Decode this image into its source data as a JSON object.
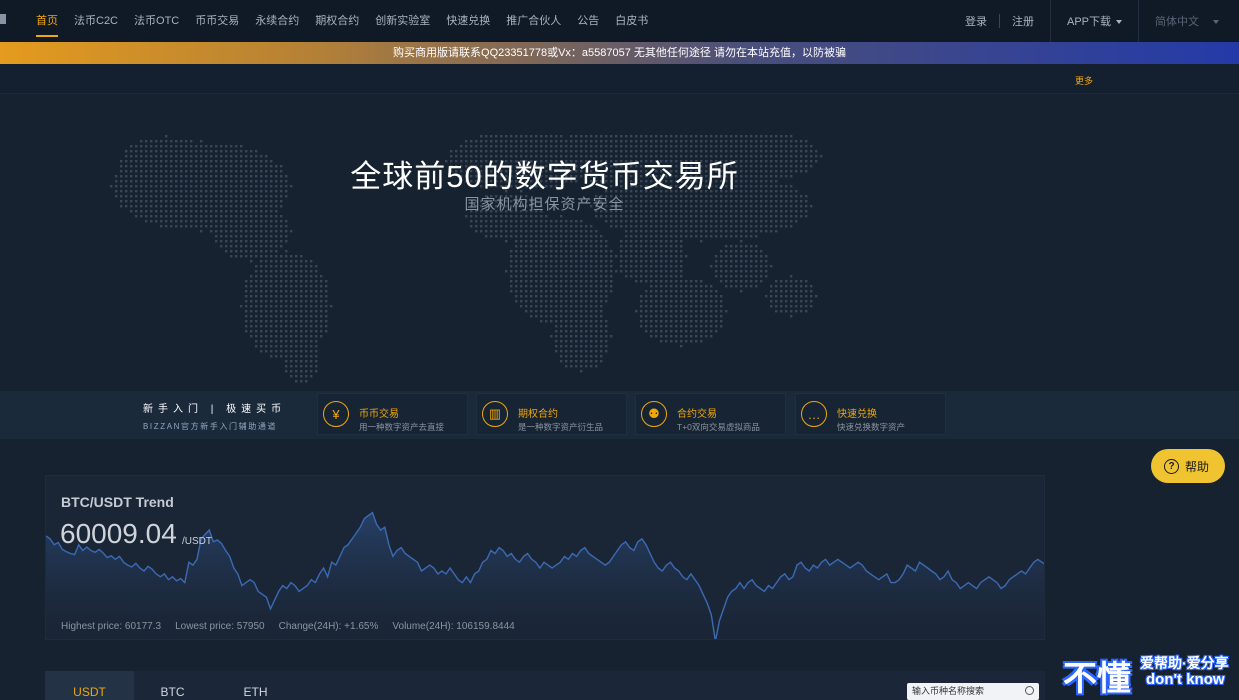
{
  "nav": {
    "items": [
      {
        "label": "首页",
        "active": true
      },
      {
        "label": "法币C2C"
      },
      {
        "label": "法币OTC"
      },
      {
        "label": "币币交易"
      },
      {
        "label": "永续合约"
      },
      {
        "label": "期权合约"
      },
      {
        "label": "创新实验室"
      },
      {
        "label": "快速兑换"
      },
      {
        "label": "推广合伙人"
      },
      {
        "label": "公告"
      },
      {
        "label": "白皮书"
      }
    ],
    "login": "登录",
    "register": "注册",
    "app_download": "APP下载",
    "language": "简体中文"
  },
  "banner": {
    "text": "购买商用版请联系QQ23351778或Vx：a5587057 无其他任何途径 请勿在本站充值，以防被骗"
  },
  "subbar": {
    "more": "更多"
  },
  "hero": {
    "title": "全球前50的数字货币交易所",
    "subtitle": "国家机构担保资产安全"
  },
  "quickbar": {
    "intro_title": "新手入门  |  极速买币",
    "intro_sub": "BIZZAN官方新手入门辅助通道",
    "cards": [
      {
        "icon": "yen-icon",
        "glyph": "¥",
        "title": "币币交易",
        "desc": "用一种数字资产去直接"
      },
      {
        "icon": "chart-icon",
        "glyph": "▥",
        "title": "期权合约",
        "desc": "是一种数字资产衍生品"
      },
      {
        "icon": "network-icon",
        "glyph": "⚉",
        "title": "合约交易",
        "desc": "T+0双向交易虚拟商品"
      },
      {
        "icon": "chat-icon",
        "glyph": "…",
        "title": "快速兑换",
        "desc": "快速兑换数字资产"
      }
    ]
  },
  "help": {
    "label": "帮助",
    "icon": "question-icon"
  },
  "chart_data": {
    "type": "area",
    "title": "BTC/USDT Trend",
    "current_price": "60009.04",
    "unit": "/USDT",
    "stats": {
      "high": "Highest price: 60177.3",
      "low": "Lowest price: 57950",
      "change": "Change(24H): +1.65%",
      "volume": "Volume(24H): 106159.8444"
    },
    "ylim": [
      57950,
      60177.3
    ],
    "values": [
      59750,
      59700,
      59600,
      59640,
      59520,
      59480,
      59450,
      59430,
      59600,
      59500,
      59560,
      59500,
      59470,
      59520,
      59460,
      59380,
      59410,
      59350,
      59400,
      59300,
      59250,
      59220,
      59280,
      59200,
      59150,
      59230,
      59180,
      59100,
      59050,
      59100,
      59000,
      59050,
      58980,
      59020,
      58950,
      59300,
      59250,
      59350,
      59700,
      59780,
      59850,
      59650,
      59680,
      59620,
      59500,
      59400,
      59200,
      59100,
      58900,
      58950,
      59000,
      58950,
      58800,
      58750,
      58700,
      58500,
      58650,
      58800,
      58900,
      58850,
      58950,
      58900,
      58800,
      58850,
      58900,
      59000,
      58950,
      59100,
      59200,
      59050,
      59300,
      59250,
      59400,
      59550,
      59600,
      59700,
      59800,
      59900,
      60050,
      60100,
      60150,
      59950,
      59850,
      59900,
      59600,
      59400,
      59500,
      59550,
      59450,
      59400,
      59350,
      59300,
      59150,
      59200,
      59250,
      59200,
      59100,
      59150,
      59100,
      59200,
      59100,
      59000,
      58950,
      59050,
      58950,
      59100,
      59150,
      59300,
      59350,
      59500,
      59450,
      59550,
      59500,
      59400,
      59450,
      59350,
      59300,
      59400,
      59450,
      59350,
      59300,
      59200,
      59300,
      59250,
      59200,
      59250,
      59300,
      59400,
      59350,
      59450,
      59400,
      59500,
      59550,
      59450,
      59400,
      59350,
      59300,
      59250,
      59300,
      59400,
      59500,
      59600,
      59650,
      59550,
      59500,
      59650,
      59700,
      59600,
      59450,
      59300,
      59200,
      59150,
      59250,
      59300,
      59200,
      59150,
      59050,
      59000,
      59100,
      59000,
      58900,
      58750,
      58600,
      58400,
      57950,
      58300,
      58500,
      58700,
      58800,
      58850,
      58950,
      58850,
      58950,
      59000,
      58900,
      58850,
      58800,
      58900,
      58850,
      58950,
      59050,
      59100,
      59000,
      59050,
      59250,
      59300,
      59200,
      59150,
      59250,
      59200,
      59300,
      59350,
      59250,
      59300,
      59350,
      59300,
      59250,
      59200,
      59250,
      59300,
      59250,
      59150,
      59100,
      59050,
      59000,
      59050,
      59100,
      58950,
      58950,
      59000,
      59100,
      59250,
      59200,
      59150,
      59300,
      59250,
      59200,
      59150,
      59100,
      59000,
      59050,
      59150,
      59000,
      58950,
      58850,
      58900,
      58950,
      58900,
      58850,
      58950,
      59000,
      59050,
      59000,
      58950,
      58850,
      58900,
      59000,
      59050,
      59100,
      59150,
      59100,
      59200,
      59300,
      59350,
      59300,
      59250
    ]
  },
  "market": {
    "tabs": [
      {
        "label": "USDT",
        "active": true
      },
      {
        "label": "BTC"
      },
      {
        "label": "ETH"
      }
    ],
    "search_placeholder": "输入币种名称搜索"
  },
  "watermark": {
    "big": "不懂",
    "line1": "爱帮助·爱分享",
    "line2": "don't know"
  },
  "colors": {
    "accent": "#f0a70a",
    "background": "#172230",
    "nav": "#0f1a26",
    "line": "#3b6ab5"
  }
}
